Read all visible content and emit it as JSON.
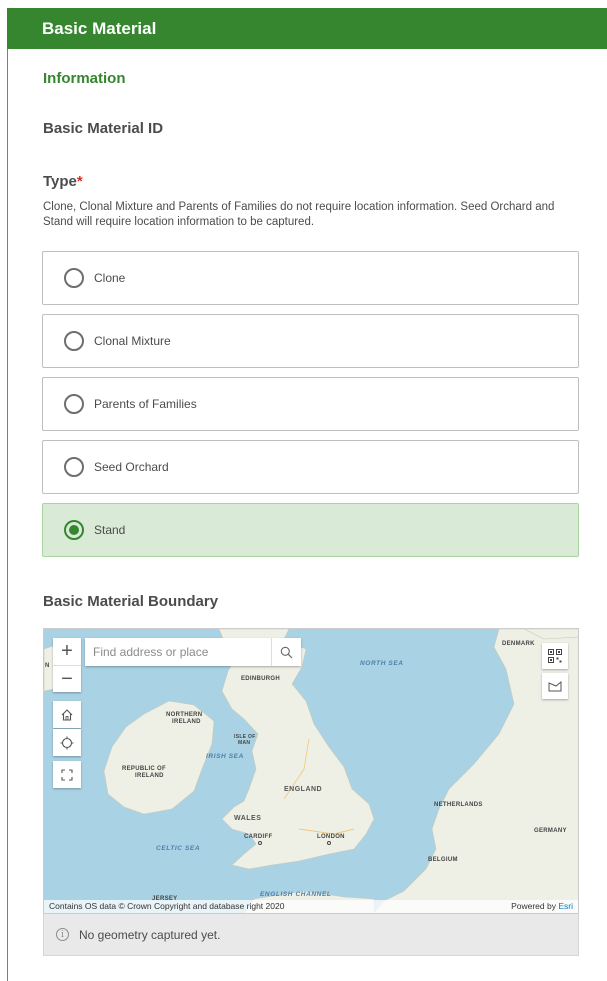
{
  "header": {
    "title": "Basic Material"
  },
  "info_section": {
    "title": "Information"
  },
  "fields": {
    "basic_material_id": {
      "label": "Basic Material ID"
    },
    "type": {
      "label": "Type",
      "required_mark": "*",
      "description": "Clone, Clonal Mixture and Parents of Families do not require location information. Seed Orchard and Stand will require location information to be captured.",
      "options": [
        {
          "label": "Clone",
          "selected": false
        },
        {
          "label": "Clonal Mixture",
          "selected": false
        },
        {
          "label": "Parents of Families",
          "selected": false
        },
        {
          "label": "Seed Orchard",
          "selected": false
        },
        {
          "label": "Stand",
          "selected": true
        }
      ]
    },
    "boundary": {
      "label": "Basic Material Boundary"
    }
  },
  "map": {
    "search_placeholder": "Find address or place",
    "zoom_in": "+",
    "zoom_out": "−",
    "labels": {
      "north_sea": "NORTH SEA",
      "denmark": "DENMARK",
      "edinburgh": "EDINBURGH",
      "northern_ireland_1": "NORTHERN",
      "northern_ireland_2": "IRELAND",
      "isle_of_man_1": "ISLE OF",
      "isle_of_man_2": "MAN",
      "irish_sea": "IRISH SEA",
      "republic_of_ireland_1": "REPUBLIC OF",
      "republic_of_ireland_2": "IRELAND",
      "england": "ENGLAND",
      "wales": "WALES",
      "cardiff": "CARDIFF",
      "london": "LONDON",
      "celtic_sea": "CELTIC SEA",
      "english_channel": "ENGLISH CHANNEL",
      "jersey": "JERSEY",
      "netherlands": "NETHERLANDS",
      "germany": "GERMANY",
      "belgium": "BELGIUM",
      "edge_n": "N"
    },
    "attribution": "Contains OS data © Crown Copyright and database right 2020",
    "powered_by": "Powered by",
    "esri": "Esri"
  },
  "geometry_status": {
    "message": "No geometry captured yet."
  },
  "colors": {
    "header_bg": "#35862f",
    "accent_green": "#35862f",
    "selected_bg": "#d9ebd6",
    "required_red": "#d83020",
    "sea": "#a9d2e5",
    "land": "#eef0e6"
  }
}
